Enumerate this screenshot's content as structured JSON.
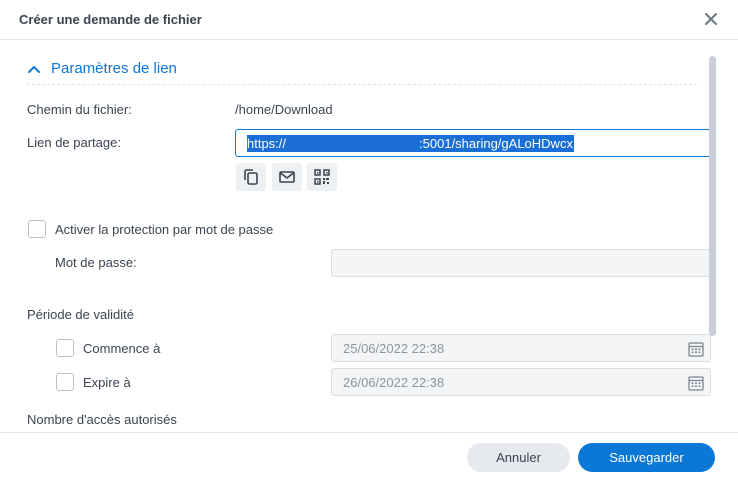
{
  "dialog": {
    "title": "Créer une demande de fichier"
  },
  "section": {
    "title": "Paramètres de lien"
  },
  "fields": {
    "path_label": "Chemin du fichier:",
    "path_value": "/home/Download",
    "link_label": "Lien de partage:",
    "link_prefix": "https://",
    "link_suffix": ":5001/sharing/gALoHDwcx"
  },
  "actions": {
    "copy_icon": "copy-icon",
    "mail_icon": "mail-icon",
    "qr_icon": "qr-code-icon"
  },
  "password": {
    "enable_label": "Activer la protection par mot de passe",
    "enabled": false,
    "label": "Mot de passe:",
    "value": ""
  },
  "validity": {
    "label": "Période de validité",
    "start_label": "Commence à",
    "start_checked": false,
    "start_value": "25/06/2022 22:38",
    "end_label": "Expire à",
    "end_checked": false,
    "end_value": "26/06/2022 22:38"
  },
  "access": {
    "label": "Nombre d'accès autorisés"
  },
  "footer": {
    "cancel_label": "Annuler",
    "save_label": "Sauvegarder"
  },
  "colors": {
    "accent": "#0b78d8",
    "selection": "#1a6fd6",
    "text": "#3a4450"
  }
}
